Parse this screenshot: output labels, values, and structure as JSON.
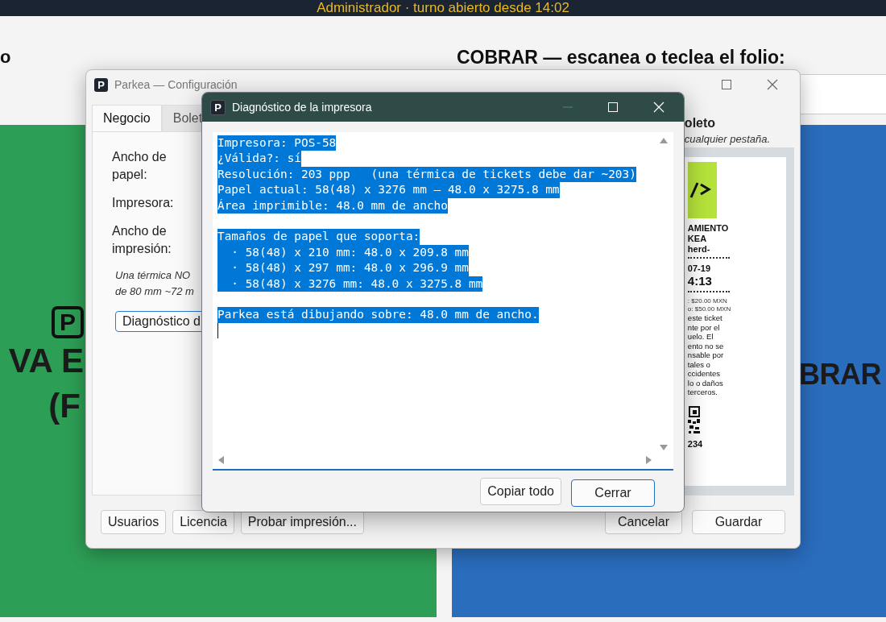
{
  "background_app": {
    "status_bar": "Administrador · turno abierto desde 14:02",
    "left_heading": "o",
    "right_heading": "COBRAR — escanea o teclea el folio:",
    "left_panel": {
      "logo": "P",
      "lines": [
        "VA E",
        "(F"
      ]
    },
    "right_panel": {
      "lines": [
        "BRAR"
      ]
    }
  },
  "config_window": {
    "app_icon": "P",
    "title": "Parkea — Configuración",
    "tabs": [
      {
        "label": "Negocio",
        "selected": true
      },
      {
        "label": "Bolet",
        "selected": false
      }
    ],
    "fields": [
      {
        "label": "Ancho de papel:"
      },
      {
        "label": "Impresora:"
      },
      {
        "label": "Ancho de impresión:"
      }
    ],
    "note_lines": [
      "Una térmica NO",
      "de 80 mm ~72 m"
    ],
    "diagnostic_button": "Diagnóstico d",
    "preview": {
      "heading": "oleto",
      "hint": "cualquier pestaña.",
      "ticket": [
        {
          "kind": "logo"
        },
        {
          "kind": "title",
          "text": "AMIENTO"
        },
        {
          "kind": "title",
          "text": "KEA"
        },
        {
          "kind": "title",
          "text": "herd-"
        },
        {
          "kind": "rule"
        },
        {
          "kind": "title",
          "text": "07-19"
        },
        {
          "kind": "big",
          "text": "4:13"
        },
        {
          "kind": "rule"
        },
        {
          "kind": "small",
          "text": ": $20.00 MXN"
        },
        {
          "kind": "small",
          "text": "o: $50.00 MXN"
        },
        {
          "kind": "body",
          "text": "este ticket"
        },
        {
          "kind": "body",
          "text": "nte por el"
        },
        {
          "kind": "body",
          "text": "uelo. El"
        },
        {
          "kind": "body",
          "text": "ento no se"
        },
        {
          "kind": "body",
          "text": "nsable por"
        },
        {
          "kind": "body",
          "text": "tales o"
        },
        {
          "kind": "body",
          "text": "ccidentes"
        },
        {
          "kind": "body",
          "text": "lo o daños"
        },
        {
          "kind": "body",
          "text": "terceros."
        },
        {
          "kind": "qr"
        },
        {
          "kind": "title",
          "text": "234"
        }
      ]
    },
    "buttons_left": [
      "Usuarios",
      "Licencia",
      "Probar impresión..."
    ],
    "buttons_right": [
      "Cancelar",
      "Guardar"
    ]
  },
  "dialog": {
    "app_icon": "P",
    "title": "Diagnóstico de la impresora",
    "text_groups": [
      [
        "Impresora: POS-58",
        "¿Válida?: sí",
        "Resolución: 203 ppp   (una térmica de tickets debe dar ~203)",
        "Papel actual: 58(48) x 3276 mm — 48.0 x 3275.8 mm",
        "Área imprimible: 48.0 mm de ancho"
      ],
      [
        "Tamaños de papel que soporta:",
        "  · 58(48) x 210 mm: 48.0 x 209.8 mm",
        "  · 58(48) x 297 mm: 48.0 x 296.9 mm",
        "  · 58(48) x 3276 mm: 48.0 x 3275.8 mm"
      ],
      [
        "Parkea está dibujando sobre: 48.0 mm de ancho."
      ]
    ],
    "selected": true,
    "buttons": [
      {
        "label": "Copiar todo",
        "default": false
      },
      {
        "label": "Cerrar",
        "default": true
      }
    ]
  }
}
